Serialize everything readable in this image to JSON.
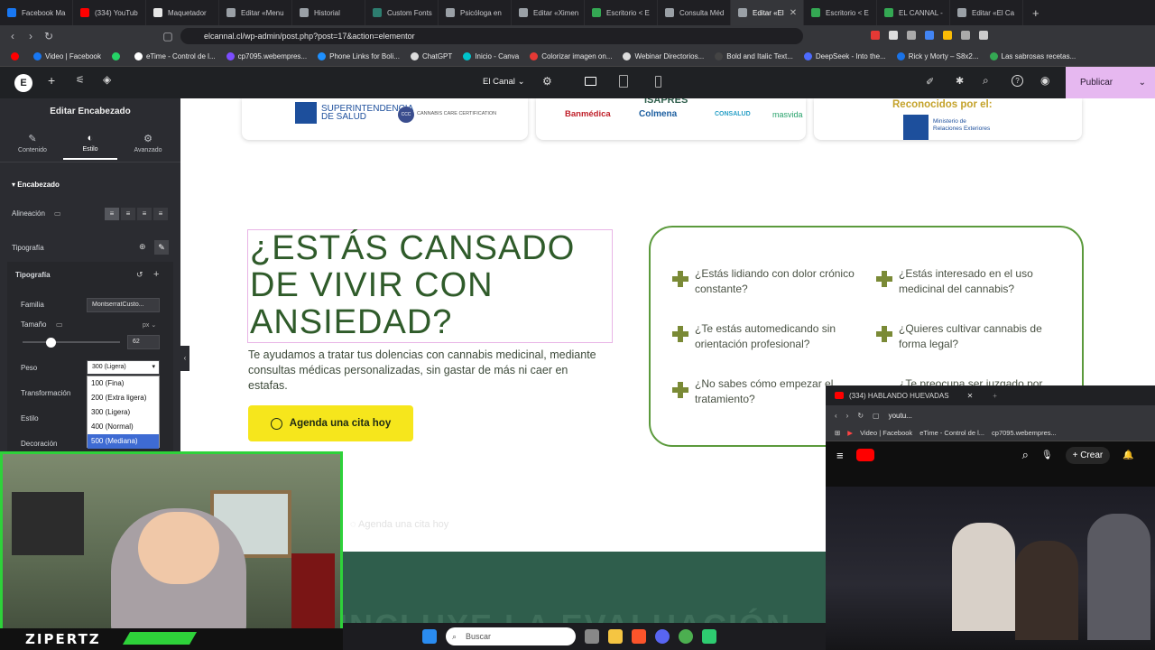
{
  "browser": {
    "tabs": [
      {
        "label": "Facebook Ma",
        "color": "#1877f2",
        "active": false
      },
      {
        "label": "(334) YouTub",
        "color": "#ff0000",
        "active": false
      },
      {
        "label": "Maquetador",
        "color": "#e6e6e6",
        "active": false
      },
      {
        "label": "Editar «Menu",
        "color": "#9aa0a6",
        "active": false
      },
      {
        "label": "Historial",
        "color": "#9aa0a6",
        "active": false
      },
      {
        "label": "Custom Fonts",
        "color": "#2d7d6f",
        "active": false
      },
      {
        "label": "Psicóloga en",
        "color": "#9aa0a6",
        "active": false
      },
      {
        "label": "Editar «Ximen",
        "color": "#9aa0a6",
        "active": false
      },
      {
        "label": "Escritorio < E",
        "color": "#34a853",
        "active": false
      },
      {
        "label": "Consulta Méd",
        "color": "#9aa0a6",
        "active": false
      },
      {
        "label": "Editar «El",
        "color": "#9aa0a6",
        "active": true
      },
      {
        "label": "Escritorio < E",
        "color": "#34a853",
        "active": false
      },
      {
        "label": "EL CANNAL -",
        "color": "#34a853",
        "active": false
      },
      {
        "label": "Editar «El Ca",
        "color": "#9aa0a6",
        "active": false
      }
    ],
    "url": "elcannal.cl/wp-admin/post.php?post=17&action=elementor",
    "bookmarks": [
      {
        "label": "",
        "color": "#ff0000"
      },
      {
        "label": "Video | Facebook",
        "color": "#1877f2"
      },
      {
        "label": "",
        "color": "#25d366"
      },
      {
        "label": "eTime - Control de l...",
        "color": "#ffffff"
      },
      {
        "label": "cp7095.webempres...",
        "color": "#7c4dff"
      },
      {
        "label": "Phone Links for Boli...",
        "color": "#1e90ff"
      },
      {
        "label": "ChatGPT",
        "color": "#dddddd"
      },
      {
        "label": "Inicio - Canva",
        "color": "#00c4cc"
      },
      {
        "label": "Colorizar imagen on...",
        "color": "#e53935"
      },
      {
        "label": "Webinar Directorios...",
        "color": "#dddddd"
      },
      {
        "label": "Bold and Italic Text...",
        "color": "#444444"
      },
      {
        "label": "DeepSeek - Into the...",
        "color": "#4d6bfe"
      },
      {
        "label": "Rick y Morty – S8x2...",
        "color": "#1a73e8"
      },
      {
        "label": "Las sabrosas recetas...",
        "color": "#34a853"
      }
    ]
  },
  "editor": {
    "site_name": "El Canal",
    "publish_label": "Publicar"
  },
  "panel": {
    "title": "Editar Encabezado",
    "tabs": [
      {
        "label": "Contenido",
        "icon": "✎"
      },
      {
        "label": "Estilo",
        "icon": "◐"
      },
      {
        "label": "Avanzado",
        "icon": "⚙"
      }
    ],
    "section": "Encabezado",
    "alignment_label": "Alineación",
    "typography_label": "Tipografía",
    "typography_group": "Tipografía",
    "family_label": "Familia",
    "family_value": "MontserratCusto...",
    "size_label": "Tamaño",
    "size_unit": "px",
    "size_value": "62",
    "weight_label": "Peso",
    "weight_value": "300 (Ligera)",
    "transform_label": "Transformación",
    "style_label": "Estilo",
    "decoration_label": "Decoración",
    "weight_options": [
      "100 (Fina)",
      "200 (Extra ligera)",
      "300 (Ligera)",
      "400 (Normal)",
      "500 (Mediana)"
    ],
    "weight_selected_index": 4
  },
  "canvas": {
    "logos": {
      "salud": "SUPERINTENDENCIA DE SALUD",
      "ccc": "CANNABIS CARE CERTIFICATION",
      "isapres": "ISAPRES",
      "banmedica": "Banmédica",
      "colmena": "Colmena",
      "consalud": "CONSALUD",
      "masvida": "masvida",
      "reconocidos": "Reconocidos por el:",
      "ministerio": "Ministerio de Relaciones Exteriores"
    },
    "hero_title": "¿ESTÁS CANSADO DE VIVIR CON ANSIEDAD?",
    "hero_desc": "Te ayudamos a tratar tus dolencias con cannabis medicinal, mediante consultas médicas personalizadas, sin gastar de más ni caer en estafas.",
    "cta_label": "Agenda una cita hoy",
    "ghost_cta": "Agenda una cita hoy",
    "questions": [
      "¿Estás lidiando con dolor crónico constante?",
      "¿Estás interesado en el uso medicinal del cannabis?",
      "¿Te estás automedicando sin orientación profesional?",
      "¿Quieres cultivar cannabis de forma legal?",
      "¿No sabes cómo empezar el tratamiento?",
      "¿Te preocupa ser juzgado por"
    ],
    "band_text": "INCLUYE LA EVALUACIÓN"
  },
  "webcam": {
    "label": "ZIPERTZ"
  },
  "youtube": {
    "tab_title": "(334) HABLANDO HUEVADAS",
    "url": "youtu...",
    "bookmarks": [
      "Video | Facebook",
      "eTime - Control de l...",
      "cp7095.webempres..."
    ],
    "create_label": "Crear"
  },
  "taskbar": {
    "search_placeholder": "Buscar"
  }
}
